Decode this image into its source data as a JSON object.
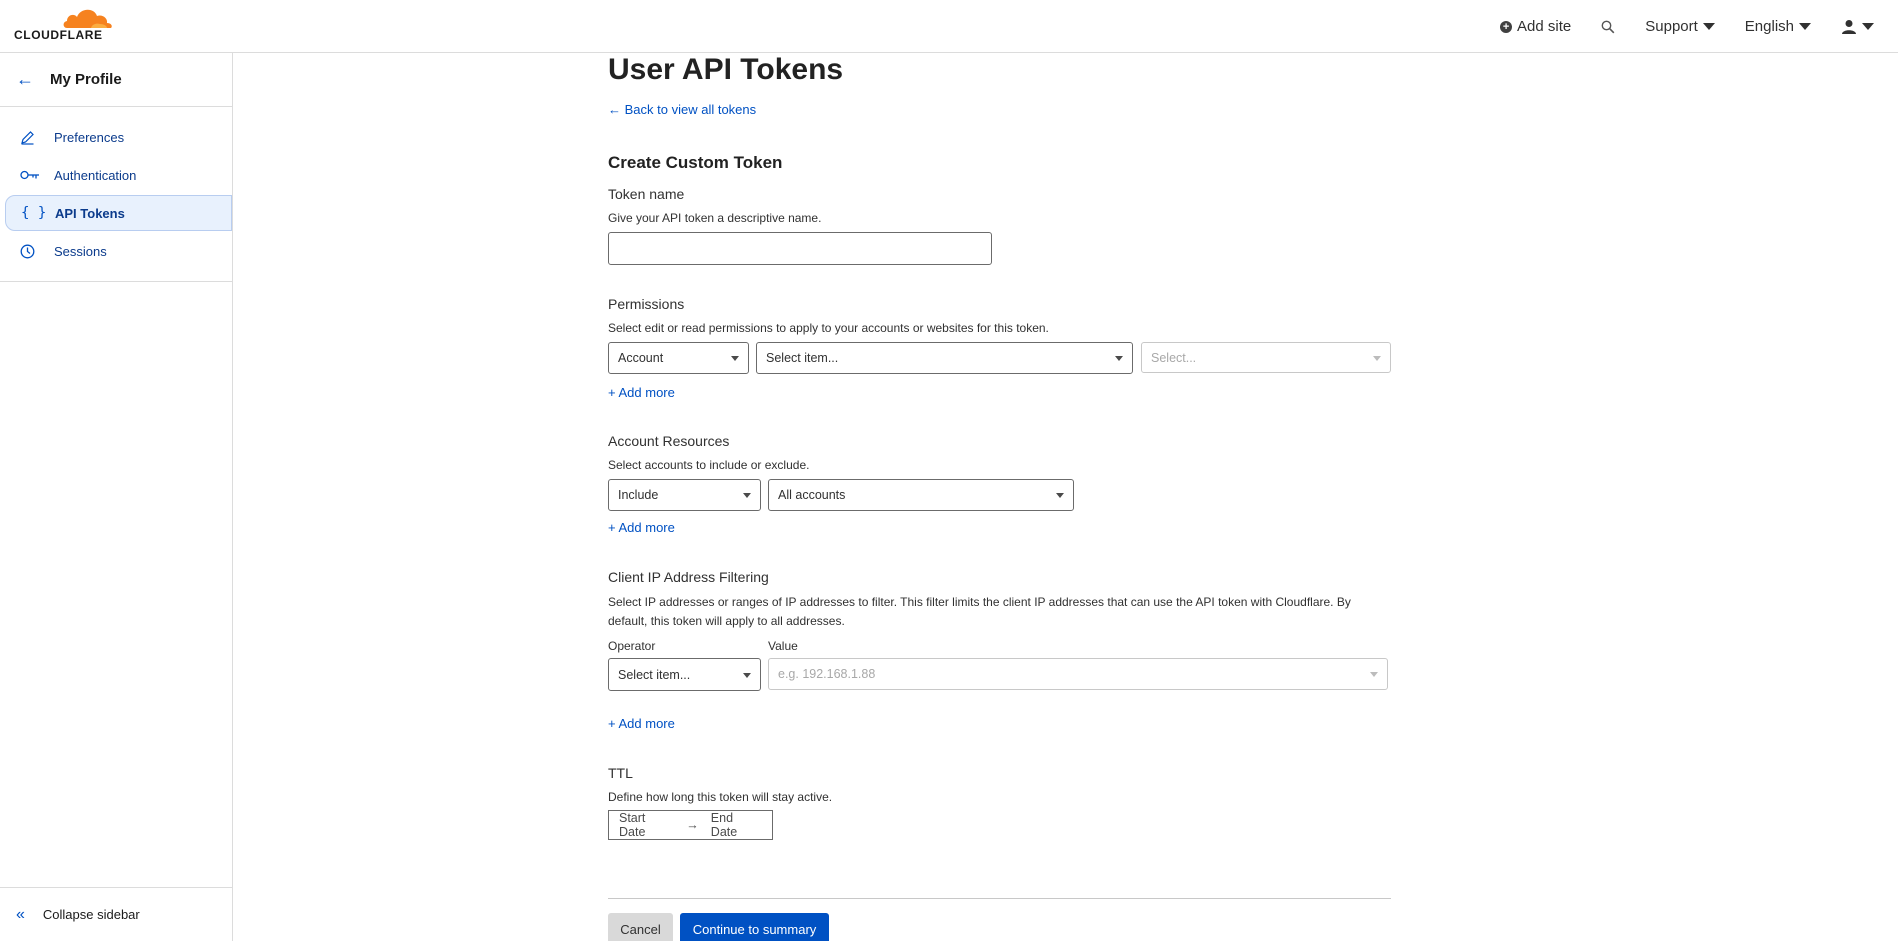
{
  "brand": {
    "logo_text": "CLOUDFLARE",
    "accent": "#0051c3",
    "logo_color": "#f6821f"
  },
  "topnav": {
    "add_site": "Add site",
    "support": "Support",
    "language": "English"
  },
  "sidebar": {
    "header": "My Profile",
    "items": [
      {
        "label": "Preferences",
        "icon": "pencil-icon"
      },
      {
        "label": "Authentication",
        "icon": "key-icon"
      },
      {
        "label": "API Tokens",
        "icon": "braces-icon",
        "active": true
      },
      {
        "label": "Sessions",
        "icon": "clock-icon"
      }
    ],
    "collapse": "Collapse sidebar"
  },
  "page": {
    "title": "User API Tokens",
    "back_link": "Back to view all tokens",
    "section_title": "Create Custom Token",
    "token_name": {
      "label": "Token name",
      "description": "Give your API token a descriptive name.",
      "value": ""
    },
    "permissions": {
      "label": "Permissions",
      "description": "Select edit or read permissions to apply to your accounts or websites for this token.",
      "scope": "Account",
      "item": "Select item...",
      "level_placeholder": "Select...",
      "add_more": "Add more"
    },
    "account_resources": {
      "label": "Account Resources",
      "description": "Select accounts to include or exclude.",
      "mode": "Include",
      "target": "All accounts",
      "add_more": "Add more"
    },
    "ip_filtering": {
      "label": "Client IP Address Filtering",
      "description": "Select IP addresses or ranges of IP addresses to filter. This filter limits the client IP addresses that can use the API token with Cloudflare. By default, this token will apply to all addresses.",
      "operator_label": "Operator",
      "value_label": "Value",
      "operator": "Select item...",
      "value_placeholder": "e.g. 192.168.1.88",
      "add_more": "Add more"
    },
    "ttl": {
      "label": "TTL",
      "description": "Define how long this token will stay active.",
      "start": "Start Date",
      "end": "End Date"
    },
    "actions": {
      "cancel": "Cancel",
      "continue": "Continue to summary"
    }
  }
}
